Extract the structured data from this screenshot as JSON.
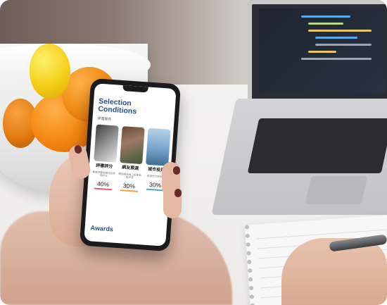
{
  "phone_screen": {
    "title": "Selection Conditions",
    "subtitle": "評選條件",
    "cards": [
      {
        "heading": "評審評分",
        "description": "專業評審依據作品表現評分",
        "percent": "40%",
        "bar_color": "#e45b6a"
      },
      {
        "heading": "網友票選",
        "description": "開放網友線上投票參與評選",
        "percent": "30%",
        "bar_color": "#f0a24a"
      },
      {
        "heading": "城市投票",
        "description": "各城市代表投票",
        "percent": "30%",
        "bar_color": "#5aa0d8"
      }
    ],
    "awards_heading": "Awards"
  },
  "colors": {
    "title": "#2b4f86",
    "phone_body": "#1b1b1d"
  }
}
